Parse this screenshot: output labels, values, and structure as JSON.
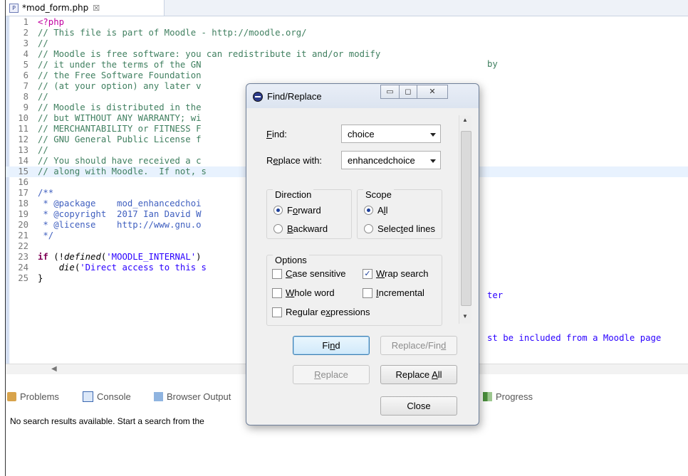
{
  "editor": {
    "tab_title": "*mod_form.php",
    "tab_close": "☒",
    "lines": [
      {
        "no": "1",
        "code": "<?php"
      },
      {
        "no": "2",
        "code": "// This file is part of Moodle - http://moodle.org/"
      },
      {
        "no": "3",
        "code": "//"
      },
      {
        "no": "4",
        "code": "// Moodle is free software: you can redistribute it and/or modify"
      },
      {
        "no": "5",
        "code": "// it under the terms of the GN"
      },
      {
        "no": "6",
        "code": "// the Free Software Foundation"
      },
      {
        "no": "7",
        "code": "// (at your option) any later v"
      },
      {
        "no": "8",
        "code": "//"
      },
      {
        "no": "9",
        "code": "// Moodle is distributed in the"
      },
      {
        "no": "10",
        "code": "// but WITHOUT ANY WARRANTY; wi"
      },
      {
        "no": "11",
        "code": "// MERCHANTABILITY or FITNESS F"
      },
      {
        "no": "12",
        "code": "// GNU General Public License f"
      },
      {
        "no": "13",
        "code": "//"
      },
      {
        "no": "14",
        "code": "// You should have received a c"
      },
      {
        "no": "15",
        "code": "// along with Moodle.  If not, s"
      },
      {
        "no": "16",
        "code": ""
      },
      {
        "no": "17",
        "code": "/**"
      },
      {
        "no": "18",
        "code": " * @package    mod_enhancedchoi"
      },
      {
        "no": "19",
        "code": " * @copyright  2017 Ian David W"
      },
      {
        "no": "20",
        "code": " * @license    http://www.gnu.o"
      },
      {
        "no": "21",
        "code": " */"
      },
      {
        "no": "22",
        "code": ""
      },
      {
        "no": "23",
        "code": "if (!defined('MOODLE_INTERNAL')"
      },
      {
        "no": "24",
        "code": "    die('Direct access to this s"
      },
      {
        "no": "25",
        "code": "}"
      }
    ],
    "right_fragments": {
      "line5": "by",
      "line20": "ter",
      "line24": "st be included from a Moodle page"
    }
  },
  "bottom_panel": {
    "tabs": [
      {
        "label": "Problems",
        "icon": "problems-icon"
      },
      {
        "label": "Console",
        "icon": "console-icon"
      },
      {
        "label": "Browser Output",
        "icon": "browser-output-icon"
      },
      {
        "label": "Progress",
        "icon": "progress-icon"
      }
    ],
    "message": "No search results available. Start a search from the"
  },
  "dialog": {
    "title": "Find/Replace",
    "find_label": "Find:",
    "find_value": "choice",
    "replace_label": "Replace with:",
    "replace_value": "enhancedchoice",
    "direction": {
      "title": "Direction",
      "forward": "Forward",
      "backward": "Backward",
      "selected": "forward"
    },
    "scope": {
      "title": "Scope",
      "all": "All",
      "selected_lines": "Selected lines",
      "selected": "all"
    },
    "options": {
      "title": "Options",
      "case_sensitive": {
        "label": "Case sensitive",
        "checked": false
      },
      "wrap_search": {
        "label": "Wrap search",
        "checked": true
      },
      "whole_word": {
        "label": "Whole word",
        "checked": false
      },
      "incremental": {
        "label": "Incremental",
        "checked": false
      },
      "regex": {
        "label": "Regular expressions",
        "checked": false
      }
    },
    "buttons": {
      "find": "Find",
      "replace_find": "Replace/Find",
      "replace": "Replace",
      "replace_all": "Replace All",
      "close": "Close"
    }
  }
}
